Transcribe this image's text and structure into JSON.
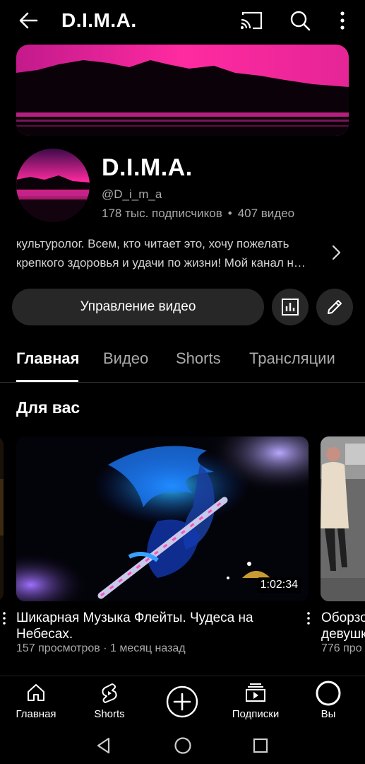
{
  "topbar": {
    "title": "D.I.M.A.",
    "icons": [
      "back-arrow-icon",
      "cast-icon",
      "search-icon",
      "more-vert-icon"
    ]
  },
  "channel": {
    "name": "D.I.M.A.",
    "handle": "@D_i_m_a",
    "subscribers": "178 тыс. подписчиков",
    "separator": "•",
    "videos": "407 видео",
    "description_line1": "культуролог. Всем, кто читает это, хочу пожелать",
    "description_line2": "крепкого здоровья и удачи по жизни! Мой канал н…"
  },
  "actions": {
    "manage_label": "Управление видео"
  },
  "tabs": [
    {
      "label": "Главная",
      "active": true
    },
    {
      "label": "Видео",
      "active": false
    },
    {
      "label": "Shorts",
      "active": false
    },
    {
      "label": "Трансляции",
      "active": false
    }
  ],
  "section": {
    "title": "Для вас"
  },
  "videos": [
    {
      "title_line1": "Шикарная Музыка Флейты. Чудеса на",
      "title_line2": "Небесах.",
      "meta": "157 просмотров · 1 месяц назад",
      "duration": "1:02:34"
    },
    {
      "title_line1": "Оборзо",
      "title_line2": "девушк",
      "meta": "776 про"
    }
  ],
  "bottom_nav": [
    {
      "label": "Главная",
      "icon": "home-icon"
    },
    {
      "label": "Shorts",
      "icon": "shorts-icon"
    },
    {
      "label": "",
      "icon": "create-plus-icon"
    },
    {
      "label": "Подписки",
      "icon": "subscriptions-icon"
    },
    {
      "label": "Вы",
      "icon": "you-avatar-icon"
    }
  ],
  "colors": {
    "background": "#000000",
    "button_bg": "#272727",
    "secondary_text": "#aaaaaa",
    "banner_magenta": "#ff2aa0"
  }
}
